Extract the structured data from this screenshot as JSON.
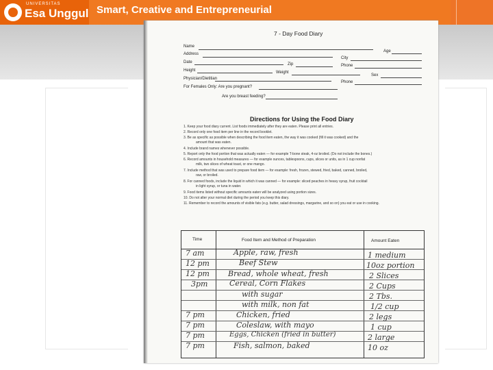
{
  "header": {
    "logo_superscript": "UNIVERSITAS",
    "logo_name": "Esa Unggul",
    "tagline": "Smart, Creative and Entrepreneurial"
  },
  "form": {
    "title": "7 - Day Food Diary",
    "name_label": "Name",
    "age_label": "Age",
    "address_label": "Address",
    "city_label": "City",
    "date_label": "Date",
    "zip_label": "Zip",
    "phone_label": "Phone",
    "height_label": "Height",
    "weight_label": "Weight",
    "sex_label": "Sex",
    "physician_label": "Physician/Dietitian",
    "phone2_label": "Phone",
    "females_label": "For Females Only: Are you pregnant?",
    "breastfeeding_label": "Are you breast feeding?"
  },
  "directions": {
    "title": "Directions for Using the Food Diary",
    "items": [
      "1. Keep your food diary current. List foods immediately after they are eaten. Please print all entries.",
      "2. Record only one food item per line in the record booklet.",
      "3. Be as specific as possible when describing the food item eaten, the way it was cooked (fill it was cooked) and the",
      "amount that was eaten.",
      "4. Include brand names whenever possible.",
      "5. Report only the food portion that was actually eaten — for example T-bone steak, 4-oz broiled. (Do not include the bones.)",
      "6. Record amounts in household measures — for example ounces, tablespoons, cups, slices or units, as in 1 cup nonfat",
      "milk, two slices of wheat toast, or one mango.",
      "7. Include method that was used to prepare food item — for example: fresh, frozen, stewed, fried, baked, canned, broiled,",
      "raw, or broiled.",
      "8. For canned foods, include the liquid in which it was canned — for example: sliced peaches in heavy syrup, fruit cocktail",
      "in light syrup, or tuna in water.",
      "9. Food items listed without specific amounts eaten will be analyzed using portion sizes.",
      "10. Do not alter your normal diet during the period you keep this diary.",
      "11. Remember to record the amounts of visible fats (e.g. butter, salad dressings, margarine, and so on) you eat or use in cooking."
    ]
  },
  "table": {
    "headers": [
      "Time",
      "Food Item and Method of Preparation",
      "Amount Eaten"
    ],
    "rows": [
      {
        "time": "7 am",
        "food": "Apple, raw, fresh",
        "amount": "1 medium"
      },
      {
        "time": "12 pm",
        "food": "Beef Stew",
        "amount": "10oz portion"
      },
      {
        "time": "12 pm",
        "food": "Bread, whole wheat, fresh",
        "amount": "2 Slices"
      },
      {
        "time": "3pm",
        "food": "Cereal, Corn Flakes",
        "amount": "2 Cups"
      },
      {
        "time": "",
        "food": "with sugar",
        "amount": "2 Tbs."
      },
      {
        "time": "",
        "food": "with milk, non fat",
        "amount": "1/2 cup"
      },
      {
        "time": "7 pm",
        "food": "Chicken, fried",
        "amount": "2 legs"
      },
      {
        "time": "7 pm",
        "food": "Coleslaw, with mayo",
        "amount": "1 cup"
      },
      {
        "time": "7 pm",
        "food": "Eggs, Chicken (fried in butter)",
        "amount": "2 large"
      },
      {
        "time": "7 pm",
        "food": "Fish, salmon, baked",
        "amount": "10 oz"
      }
    ]
  }
}
